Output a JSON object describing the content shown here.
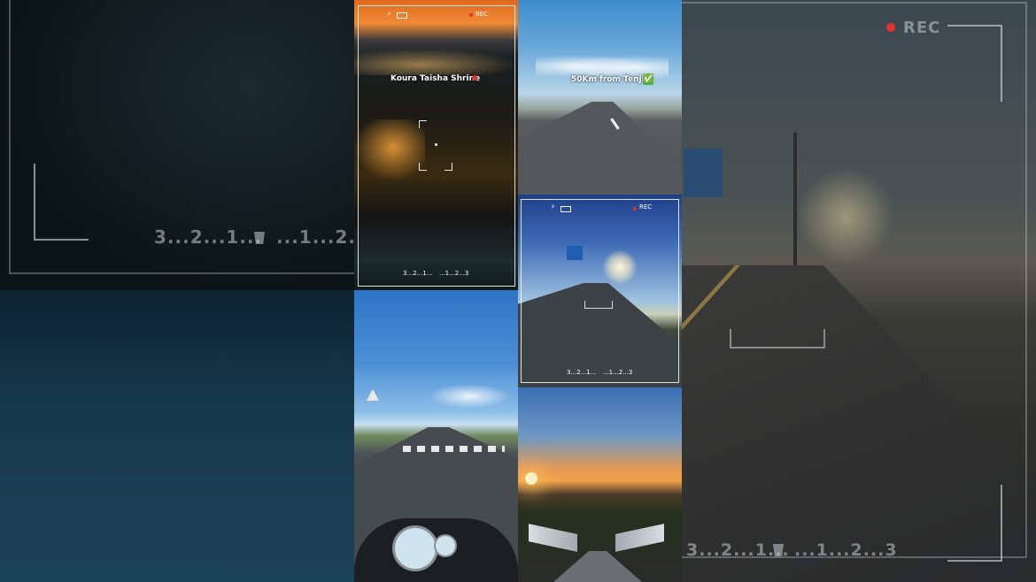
{
  "overlays": {
    "countdown": "3...2...1...",
    "countup": "...1...2...3",
    "rec": "REC"
  },
  "tiles": {
    "shrine_caption": "Koura Taisha Shrine",
    "road_caption": "50Km from Tenjin",
    "road_caption_emoji": "✅"
  },
  "colors": {
    "rec_dot": "#e0332d",
    "check_green": "#3bb54a"
  }
}
